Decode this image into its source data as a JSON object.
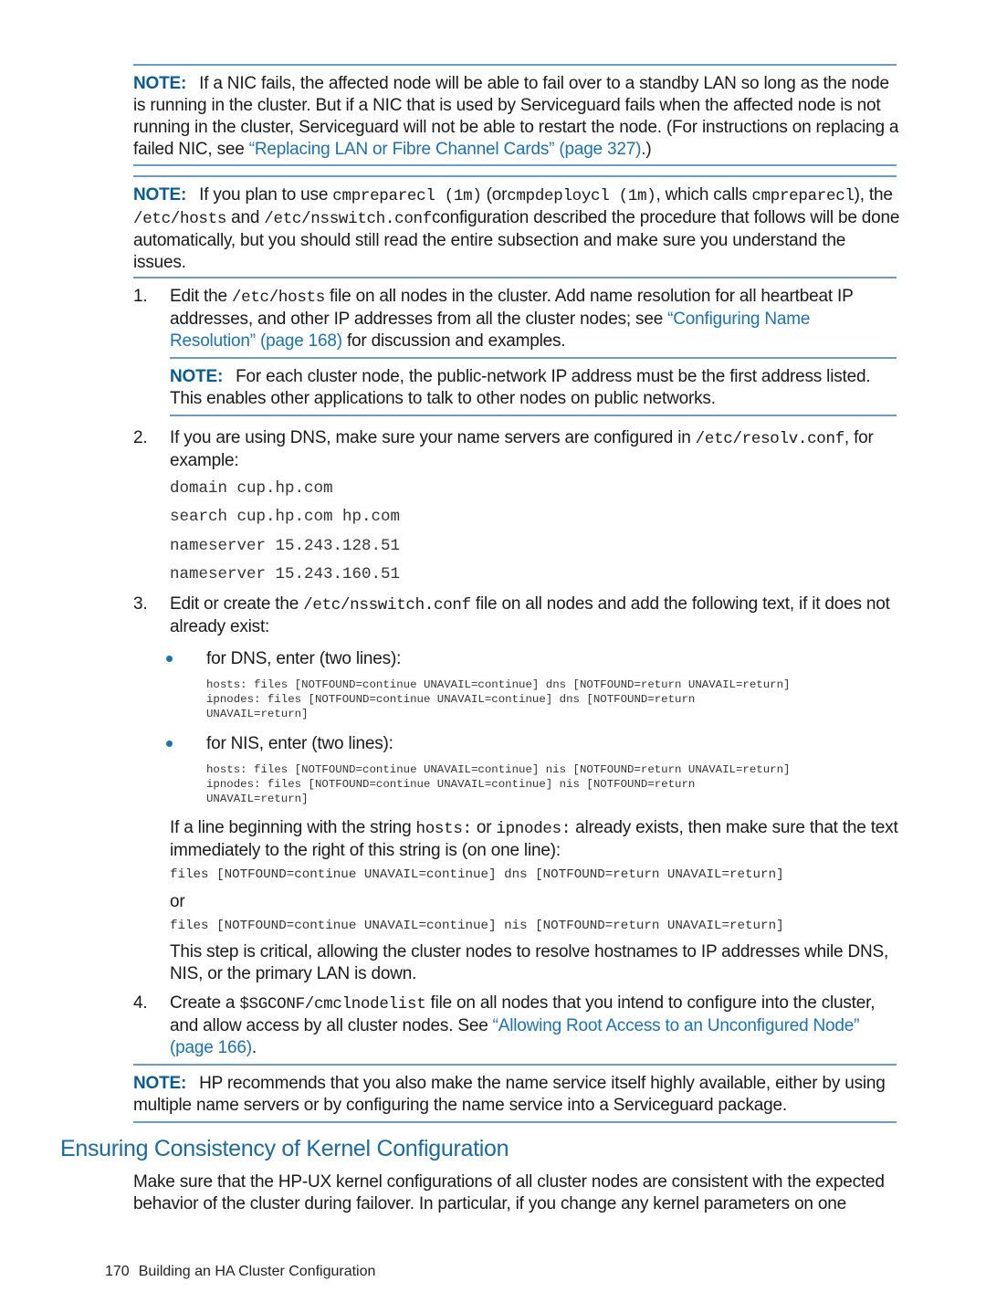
{
  "note1": {
    "label": "NOTE:",
    "text": "If a NIC fails, the affected node will be able to fail over to a standby LAN so long as the node is running in the cluster. But if a NIC that is used by Serviceguard fails when the affected node is not running in the cluster, Serviceguard will not be able to restart the node. (For instructions on replacing a failed NIC, see ",
    "link": "“Replacing LAN or Fibre Channel Cards” (page 327)",
    "tail": ".)"
  },
  "note2": {
    "label": "NOTE:",
    "t1": "If you plan to use ",
    "c1": "cmpreparecl (1m)",
    "t2": " (or",
    "c2": "cmpdeploycl (1m)",
    "t3": ", which calls ",
    "c3": "cmpreparecl",
    "t4": "), the ",
    "c4": "/etc/hosts",
    "t5": " and ",
    "c5": "/etc/nsswitch.conf",
    "t6": "configuration described the procedure that follows will be done automatically, but you should still read the entire subsection and make sure you understand the issues."
  },
  "steps": [
    {
      "num": "1.",
      "t1": "Edit the ",
      "c1": "/etc/hosts",
      "t2": " file on all nodes in the cluster. Add name resolution for all heartbeat IP addresses, and other IP addresses from all the cluster nodes; see ",
      "link": "“Configuring Name Resolution” (page 168)",
      "t3": " for discussion and examples.",
      "note": {
        "label": "NOTE:",
        "text": "For each cluster node, the public-network IP address must be the first address listed. This enables other applications to talk to other nodes on public networks."
      }
    },
    {
      "num": "2.",
      "t1": "If you are using DNS, make sure your name servers are configured in ",
      "c1": "/etc/resolv.conf",
      "t2": ", for example:",
      "code": [
        "domain cup.hp.com",
        "search cup.hp.com hp.com",
        "nameserver 15.243.128.51",
        "nameserver 15.243.160.51"
      ]
    },
    {
      "num": "3.",
      "t1": "Edit or create the ",
      "c1": "/etc/nsswitch.conf",
      "t2": " file on all nodes and add the following text, if it does not already exist:",
      "bullets": [
        {
          "label": "for DNS, enter (two lines):",
          "code": "hosts: files [NOTFOUND=continue UNAVAIL=continue] dns [NOTFOUND=return UNAVAIL=return]\nipnodes: files [NOTFOUND=continue UNAVAIL=continue] dns [NOTFOUND=return\nUNAVAIL=return]"
        },
        {
          "label": "for NIS, enter (two lines):",
          "code": "hosts: files [NOTFOUND=continue UNAVAIL=continue] nis [NOTFOUND=return UNAVAIL=return]\nipnodes: files [NOTFOUND=continue UNAVAIL=continue] nis [NOTFOUND=return\nUNAVAIL=return]"
        }
      ],
      "p1_t1": "If a line beginning with the string ",
      "p1_c1": "hosts:",
      "p1_t2": " or ",
      "p1_c2": "ipnodes:",
      "p1_t3": " already exists, then make sure that the text immediately to the right of this string is (on one line):",
      "code_dns": "files [NOTFOUND=continue UNAVAIL=continue] dns [NOTFOUND=return UNAVAIL=return]",
      "or": "or",
      "code_nis": "files [NOTFOUND=continue UNAVAIL=continue] nis [NOTFOUND=return UNAVAIL=return]",
      "p2": "This step is critical, allowing the cluster nodes to resolve hostnames to IP addresses while DNS, NIS, or the primary LAN is down."
    },
    {
      "num": "4.",
      "t1": "Create a ",
      "c1": "$SGCONF/cmclnodelist",
      "t2": " file on all nodes that you intend to configure into the cluster, and allow access by all cluster nodes. See ",
      "link": "“Allowing Root Access to an Unconfigured Node” (page 166)",
      "t3": "."
    }
  ],
  "note3": {
    "label": "NOTE:",
    "text": "HP recommends that you also make the name service itself highly available, either by using multiple name servers or by configuring the name service into a Serviceguard package."
  },
  "section": {
    "heading": "Ensuring Consistency of Kernel Configuration",
    "body": "Make sure that the HP-UX kernel configurations of all cluster nodes are consistent with the expected behavior of the cluster during failover. In particular, if you change any kernel parameters on one"
  },
  "footer": {
    "page_number": "170",
    "title": "Building an HA Cluster Configuration"
  }
}
